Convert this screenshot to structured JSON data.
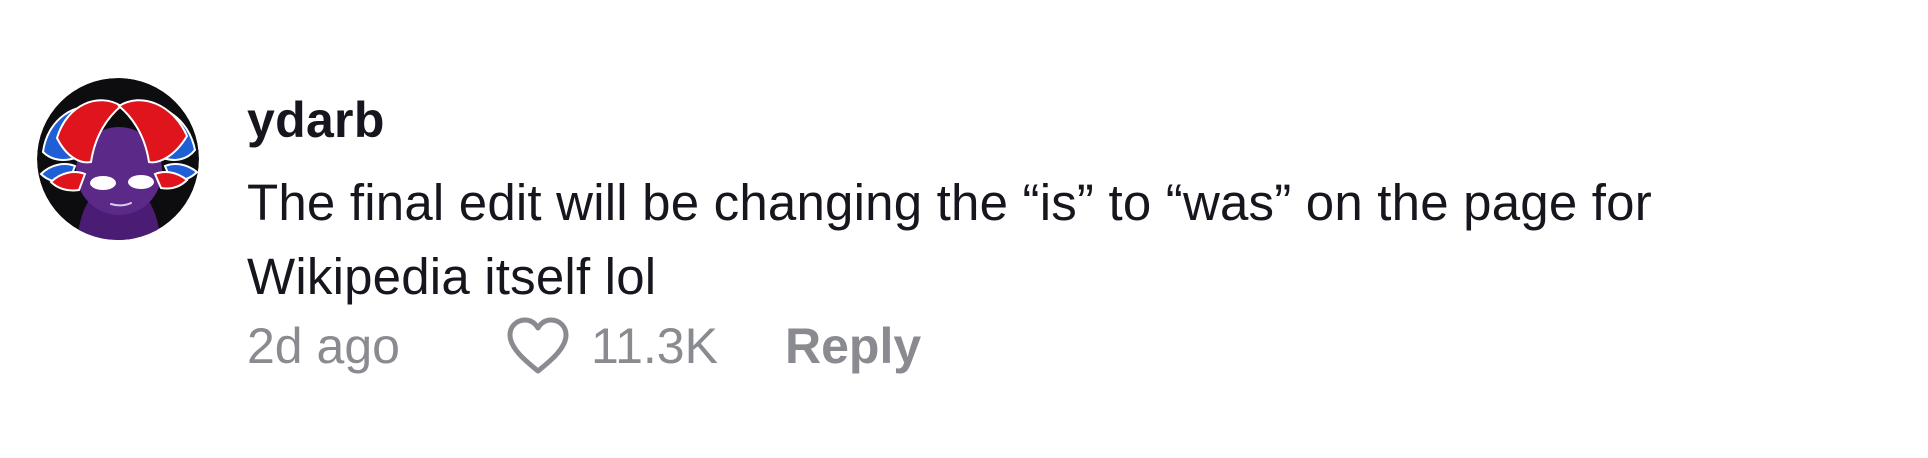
{
  "comment": {
    "username": "ydarb",
    "text_lines": [
      "The final edit will be changing the “is” to “was” on the page for",
      "Wikipedia itself lol"
    ],
    "timestamp": "2d ago",
    "like_count": "11.3K",
    "reply_label": "Reply",
    "avatar_icon": "cartoon-character-avatar-icon",
    "like_icon": "heart-outline-icon"
  },
  "colors": {
    "text_primary": "#16161e",
    "text_secondary": "#8a8b91",
    "background": "#ffffff"
  }
}
